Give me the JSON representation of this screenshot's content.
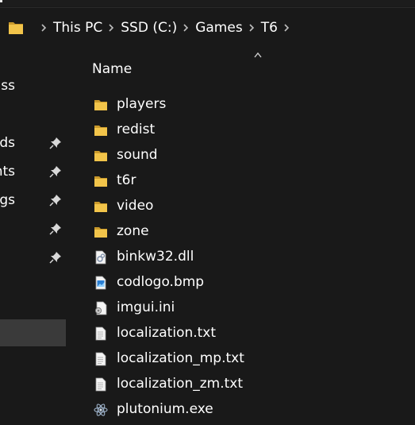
{
  "breadcrumb": {
    "items": [
      {
        "label": "This PC"
      },
      {
        "label": "SSD (C:)"
      },
      {
        "label": "Games"
      },
      {
        "label": "T6"
      }
    ]
  },
  "nav": {
    "items": [
      {
        "label": "ss",
        "pinned": false
      },
      {
        "label": "ds",
        "pinned": true
      },
      {
        "label": "nts",
        "pinned": true
      },
      {
        "label": "ings",
        "pinned": true
      },
      {
        "label": "",
        "pinned": true
      },
      {
        "label": "",
        "pinned": true
      }
    ]
  },
  "file_list": {
    "column_header": "Name",
    "items": [
      {
        "name": "players",
        "icon": "folder-icon"
      },
      {
        "name": "redist",
        "icon": "folder-icon"
      },
      {
        "name": "sound",
        "icon": "folder-icon"
      },
      {
        "name": "t6r",
        "icon": "folder-icon"
      },
      {
        "name": "video",
        "icon": "folder-icon"
      },
      {
        "name": "zone",
        "icon": "folder-icon"
      },
      {
        "name": "binkw32.dll",
        "icon": "dll-file-icon"
      },
      {
        "name": "codlogo.bmp",
        "icon": "image-file-icon"
      },
      {
        "name": "imgui.ini",
        "icon": "config-file-icon"
      },
      {
        "name": "localization.txt",
        "icon": "text-file-icon"
      },
      {
        "name": "localization_mp.txt",
        "icon": "text-file-icon"
      },
      {
        "name": "localization_zm.txt",
        "icon": "text-file-icon"
      },
      {
        "name": "plutonium.exe",
        "icon": "app-icon"
      }
    ]
  },
  "colors": {
    "background": "#191919",
    "folder": "#f2c44a",
    "selected_nav": "#3a3a3a",
    "text": "#ffffff"
  }
}
